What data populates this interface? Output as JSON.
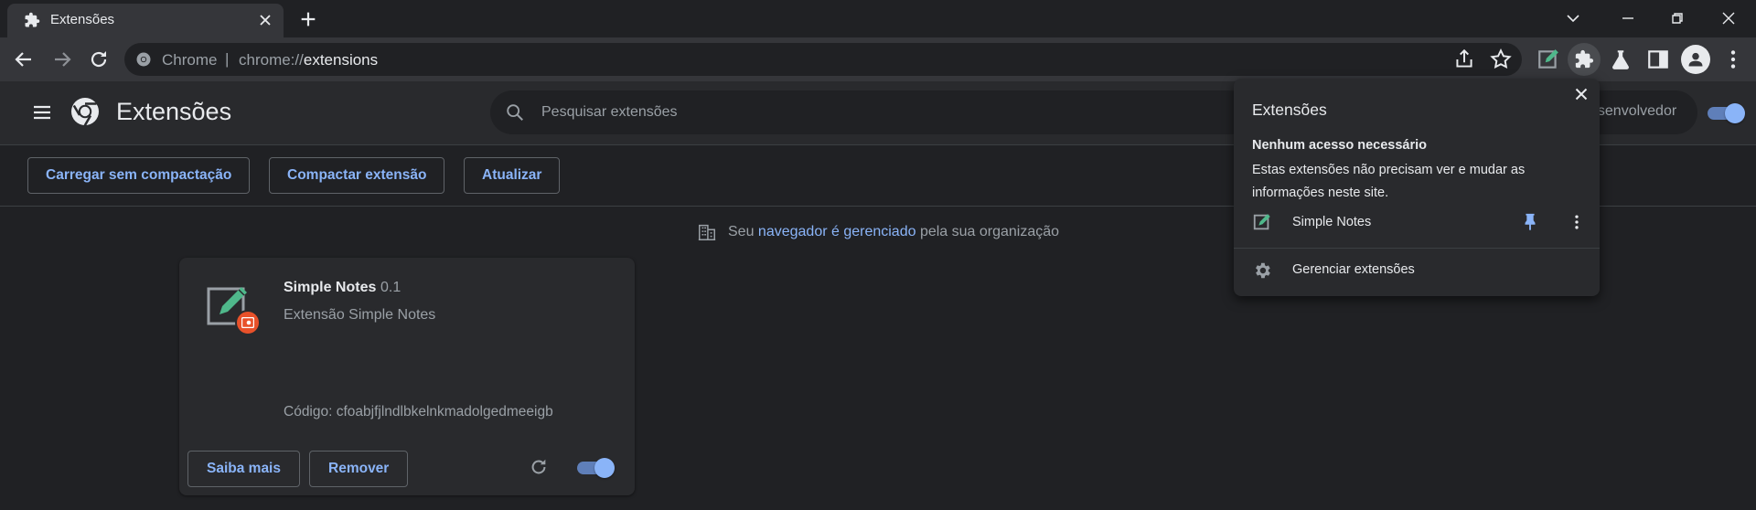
{
  "browser": {
    "tab_title": "Extensões",
    "omnibox": {
      "origin_label": "Chrome",
      "separator": "|",
      "url_scheme": "chrome://",
      "url_host": "extensions"
    }
  },
  "header": {
    "title": "Extensões",
    "search_placeholder": "Pesquisar extensões",
    "developer_mode_label": "esenvolvedor",
    "developer_mode_on": true
  },
  "actions": {
    "load_unpacked": "Carregar sem compactação",
    "pack_extension": "Compactar extensão",
    "update": "Atualizar"
  },
  "managed_notice": {
    "prefix": "Seu ",
    "link": "navegador é gerenciado",
    "suffix": " pela sua organização"
  },
  "extension_card": {
    "name": "Simple Notes",
    "version": "0.1",
    "description": "Extensão Simple Notes",
    "id_text": "Código: cfoabjfjlndlbkelnkmadolgedmeeigb",
    "details_button": "Saiba mais",
    "remove_button": "Remover",
    "enabled": true
  },
  "extensions_popup": {
    "title": "Extensões",
    "section_heading": "Nenhum acesso necessário",
    "section_description": "Estas extensões não precisam ver e mudar as informações neste site.",
    "item_name": "Simple Notes",
    "manage_label": "Gerenciar extensões"
  },
  "colors": {
    "accent": "#8ab4f8",
    "background": "#202124",
    "surface": "#292a2d",
    "badge": "#e8512a",
    "extension_green": "#4fb88b"
  },
  "icons": [
    "puzzle-icon",
    "close-icon",
    "plus-icon",
    "chevron-down-icon",
    "minimize-icon",
    "restore-icon",
    "back-icon",
    "forward-icon",
    "reload-icon",
    "share-icon",
    "star-icon",
    "lab-icon",
    "side-panel-icon",
    "profile-icon",
    "more-vert-icon",
    "hamburger-icon",
    "chrome-logo-icon",
    "search-icon",
    "building-icon",
    "pin-icon",
    "gear-icon",
    "notes-icon"
  ]
}
